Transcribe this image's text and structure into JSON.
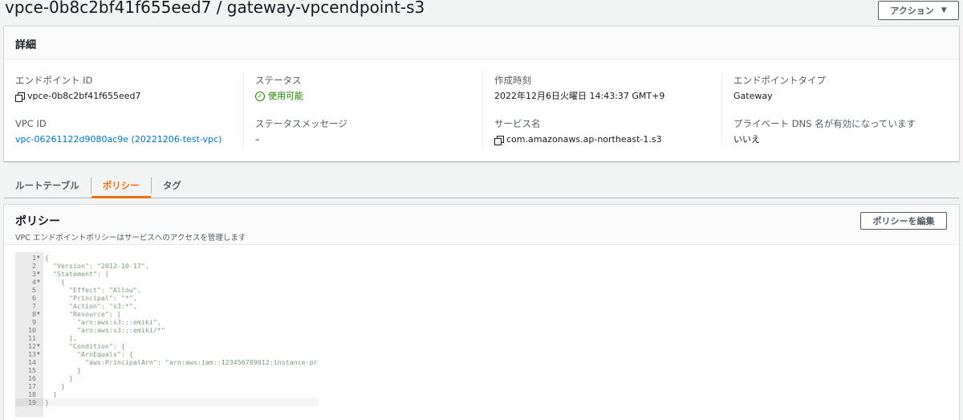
{
  "header": {
    "title": "vpce-0b8c2bf41f655eed7 / gateway-vpcendpoint-s3",
    "actions_label": "アクション"
  },
  "details": {
    "heading": "詳細",
    "fields": {
      "endpoint_id": {
        "label": "エンドポイント ID",
        "value": "vpce-0b8c2bf41f655eed7"
      },
      "vpc_id": {
        "label": "VPC ID",
        "value": "vpc-06261122d9080ac9e (20221206-test-vpc)"
      },
      "status": {
        "label": "ステータス",
        "value": "使用可能"
      },
      "status_message": {
        "label": "ステータスメッセージ",
        "value": "–"
      },
      "created": {
        "label": "作成時刻",
        "value": "2022年12月6日火曜日 14:43:37 GMT+9"
      },
      "service_name": {
        "label": "サービス名",
        "value": "com.amazonaws.ap-northeast-1.s3"
      },
      "endpoint_type": {
        "label": "エンドポイントタイプ",
        "value": "Gateway"
      },
      "private_dns": {
        "label": "プライベート DNS 名が有効になっています",
        "value": "いいえ"
      }
    }
  },
  "tabs": [
    {
      "label": "ルートテーブル",
      "active": false
    },
    {
      "label": "ポリシー",
      "active": true
    },
    {
      "label": "タグ",
      "active": false
    }
  ],
  "policy": {
    "title": "ポリシー",
    "description": "VPC エンドポイントポリシーはサービスへのアクセスを管理します",
    "edit_label": "ポリシーを編集",
    "code_lines": [
      {
        "n": "1",
        "fold": true,
        "text": "{"
      },
      {
        "n": "2",
        "fold": false,
        "text": "  \"Version\": \"2012-10-17\","
      },
      {
        "n": "3",
        "fold": true,
        "text": "  \"Statement\": ["
      },
      {
        "n": "4",
        "fold": true,
        "text": "    {"
      },
      {
        "n": "5",
        "fold": false,
        "text": "      \"Effect\": \"Allow\","
      },
      {
        "n": "6",
        "fold": false,
        "text": "      \"Principal\": \"*\","
      },
      {
        "n": "7",
        "fold": false,
        "text": "      \"Action\": \"s3:*\","
      },
      {
        "n": "8",
        "fold": true,
        "text": "      \"Resource\": ["
      },
      {
        "n": "9",
        "fold": false,
        "text": "        \"arn:aws:s3:::emiki\","
      },
      {
        "n": "10",
        "fold": false,
        "text": "        \"arn:aws:s3:::emiki/*\""
      },
      {
        "n": "11",
        "fold": false,
        "text": "      ],"
      },
      {
        "n": "12",
        "fold": true,
        "text": "      \"Condition\": {"
      },
      {
        "n": "13",
        "fold": true,
        "text": "        \"ArnEquals\": {"
      },
      {
        "n": "14",
        "fold": false,
        "text": "          \"aws:PrincipalArn\": \"arn:aws:iam::123456789012:instance-pr"
      },
      {
        "n": "15",
        "fold": false,
        "text": "        }"
      },
      {
        "n": "16",
        "fold": false,
        "text": "      }"
      },
      {
        "n": "17",
        "fold": false,
        "text": "    }"
      },
      {
        "n": "18",
        "fold": false,
        "text": "  ]"
      },
      {
        "n": "19",
        "fold": false,
        "text": "}"
      }
    ]
  }
}
